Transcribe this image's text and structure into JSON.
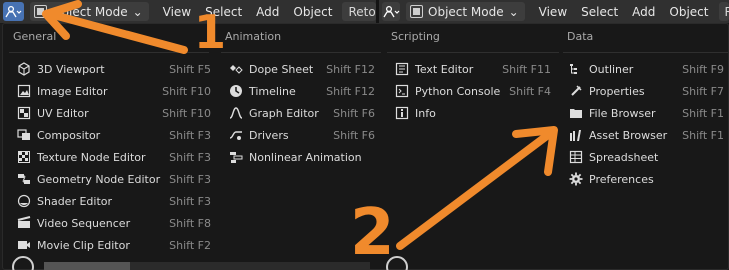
{
  "header_left": {
    "mode": "Object Mode",
    "menus": [
      "View",
      "Select",
      "Add",
      "Object"
    ],
    "retop": "Retop"
  },
  "header_right": {
    "mode": "Object Mode",
    "menus": [
      "View",
      "Select",
      "Add",
      "Object"
    ],
    "retop": "Re"
  },
  "popup": {
    "columns": [
      {
        "title": "General",
        "items": [
          {
            "label": "3D Viewport",
            "shortcut": "Shift F5",
            "icon": "cube-icon"
          },
          {
            "label": "Image Editor",
            "shortcut": "Shift F10",
            "icon": "image-icon"
          },
          {
            "label": "UV Editor",
            "shortcut": "Shift F10",
            "icon": "uv-icon"
          },
          {
            "label": "Compositor",
            "shortcut": "Shift F3",
            "icon": "compositor-icon"
          },
          {
            "label": "Texture Node Editor",
            "shortcut": "Shift F3",
            "icon": "texture-icon"
          },
          {
            "label": "Geometry Node Editor",
            "shortcut": "Shift F3",
            "icon": "geometry-node-icon"
          },
          {
            "label": "Shader Editor",
            "shortcut": "Shift F3",
            "icon": "shader-icon"
          },
          {
            "label": "Video Sequencer",
            "shortcut": "Shift F8",
            "icon": "sequencer-icon"
          },
          {
            "label": "Movie Clip Editor",
            "shortcut": "Shift F2",
            "icon": "movie-clip-icon"
          }
        ]
      },
      {
        "title": "Animation",
        "items": [
          {
            "label": "Dope Sheet",
            "shortcut": "Shift F12",
            "icon": "dopesheet-icon"
          },
          {
            "label": "Timeline",
            "shortcut": "Shift F12",
            "icon": "timeline-icon"
          },
          {
            "label": "Graph Editor",
            "shortcut": "Shift F6",
            "icon": "graph-icon"
          },
          {
            "label": "Drivers",
            "shortcut": "Shift F6",
            "icon": "drivers-icon"
          },
          {
            "label": "Nonlinear Animation",
            "shortcut": "",
            "icon": "nla-icon"
          }
        ]
      },
      {
        "title": "Scripting",
        "items": [
          {
            "label": "Text Editor",
            "shortcut": "Shift F11",
            "icon": "text-icon"
          },
          {
            "label": "Python Console",
            "shortcut": "Shift F4",
            "icon": "console-icon"
          },
          {
            "label": "Info",
            "shortcut": "",
            "icon": "info-icon"
          }
        ]
      },
      {
        "title": "Data",
        "items": [
          {
            "label": "Outliner",
            "shortcut": "Shift F9",
            "icon": "outliner-icon"
          },
          {
            "label": "Properties",
            "shortcut": "Shift F7",
            "icon": "properties-icon"
          },
          {
            "label": "File Browser",
            "shortcut": "Shift F1",
            "icon": "folder-icon"
          },
          {
            "label": "Asset Browser",
            "shortcut": "Shift F1",
            "icon": "asset-icon"
          },
          {
            "label": "Spreadsheet",
            "shortcut": "",
            "icon": "spreadsheet-icon"
          },
          {
            "label": "Preferences",
            "shortcut": "",
            "icon": "gear-icon"
          }
        ]
      }
    ]
  },
  "annotations": {
    "label_1": "1",
    "label_2": "2",
    "color": "#f08a2c"
  }
}
